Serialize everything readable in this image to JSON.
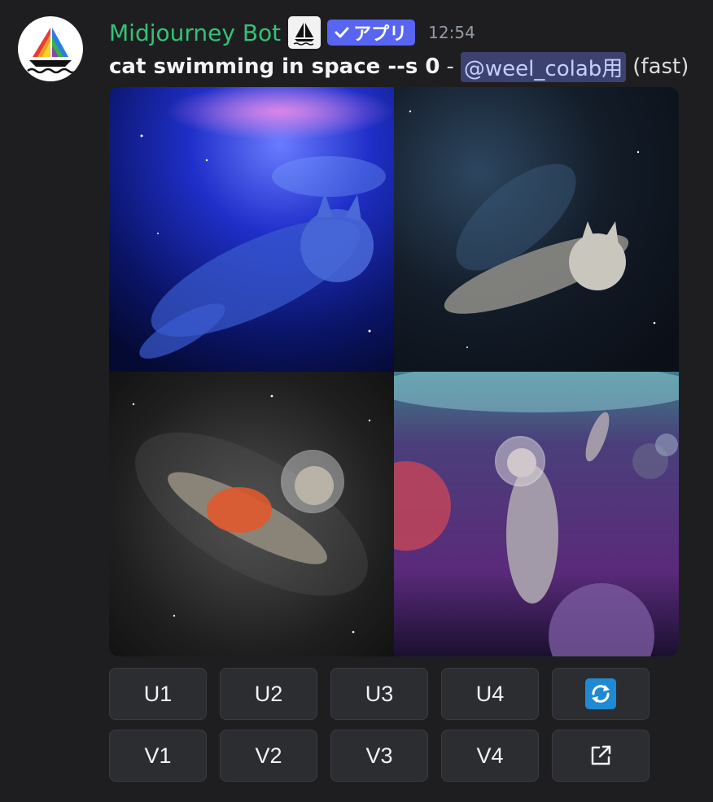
{
  "message": {
    "author": "Midjourney Bot",
    "badge": "アプリ",
    "timestamp": "12:54",
    "prompt": "cat swimming in space --s 0",
    "separator": "-",
    "mention": "@weel_colab用",
    "speed": "(fast)"
  },
  "images": [
    {
      "name": "image-cat-blue-nebula"
    },
    {
      "name": "image-cat-dark-space"
    },
    {
      "name": "image-cat-astronaut-helmet"
    },
    {
      "name": "image-cat-purple-planets"
    }
  ],
  "buttons": {
    "upscale": [
      "U1",
      "U2",
      "U3",
      "U4"
    ],
    "variation": [
      "V1",
      "V2",
      "V3",
      "V4"
    ],
    "reroll_icon": "refresh-icon",
    "open_icon": "external-link-icon"
  },
  "colors": {
    "author": "#33c376",
    "badge": "#5865f2",
    "mention_bg": "#3c4270",
    "button_bg": "#2b2d31",
    "reroll": "#1f8ad2"
  }
}
